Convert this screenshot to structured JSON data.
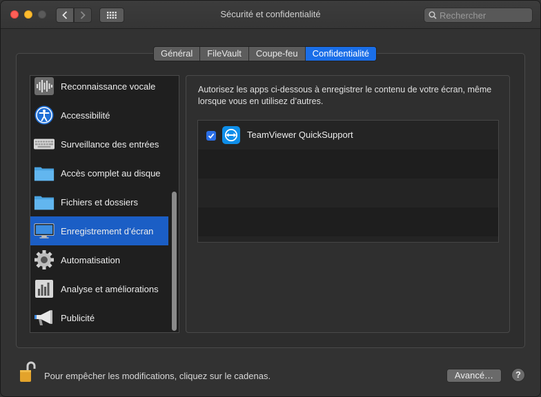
{
  "window": {
    "title": "Sécurité et confidentialité"
  },
  "toolbar": {
    "search_placeholder": "Rechercher"
  },
  "tabs": [
    {
      "label": "Général",
      "active": false
    },
    {
      "label": "FileVault",
      "active": false
    },
    {
      "label": "Coupe-feu",
      "active": false
    },
    {
      "label": "Confidentialité",
      "active": true
    }
  ],
  "sidebar": {
    "items": [
      {
        "label": "Reconnaissance vocale",
        "icon": "waveform-icon"
      },
      {
        "label": "Accessibilité",
        "icon": "accessibility-icon"
      },
      {
        "label": "Surveillance des entrées",
        "icon": "keyboard-icon"
      },
      {
        "label": "Accès complet au disque",
        "icon": "folder-icon"
      },
      {
        "label": "Fichiers et dossiers",
        "icon": "folder-icon"
      },
      {
        "label": "Enregistrement d’écran",
        "icon": "display-icon",
        "selected": true
      },
      {
        "label": "Automatisation",
        "icon": "gear-icon"
      },
      {
        "label": "Analyse et améliorations",
        "icon": "bar-chart-icon"
      },
      {
        "label": "Publicité",
        "icon": "megaphone-icon"
      }
    ]
  },
  "content": {
    "description": "Autorisez les apps ci-dessous à enregistrer le contenu de votre écran, même lorsque vous en utilisez d’autres.",
    "apps": [
      {
        "name": "TeamViewer QuickSupport",
        "checked": true,
        "icon": "teamviewer-icon"
      }
    ]
  },
  "footer": {
    "lock_message": "Pour empêcher les modifications, cliquez sur le cadenas.",
    "advanced_label": "Avancé…",
    "help_label": "?"
  },
  "colors": {
    "accent": "#1a6ee8",
    "selection": "#1b5ec5",
    "close": "#fe5f57",
    "minimize": "#febc2e"
  }
}
